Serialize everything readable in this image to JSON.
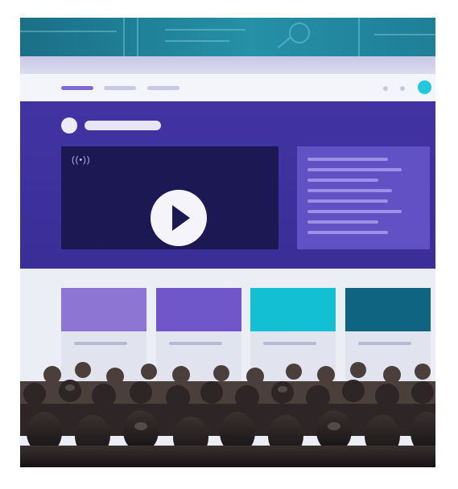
{
  "hero": {
    "live_icon": "((•))"
  },
  "icons": {
    "live": "live-broadcast-icon",
    "play": "play-icon"
  },
  "colors": {
    "banner": "#1f7f97",
    "hero": "#4233a2",
    "video": "#1c1854",
    "text_panel": "#6251c4",
    "accent": "#22c7de",
    "card_1": "#8d75d4",
    "card_2": "#6f57c9",
    "card_3": "#13bfd2",
    "card_4": "#0f6581"
  }
}
